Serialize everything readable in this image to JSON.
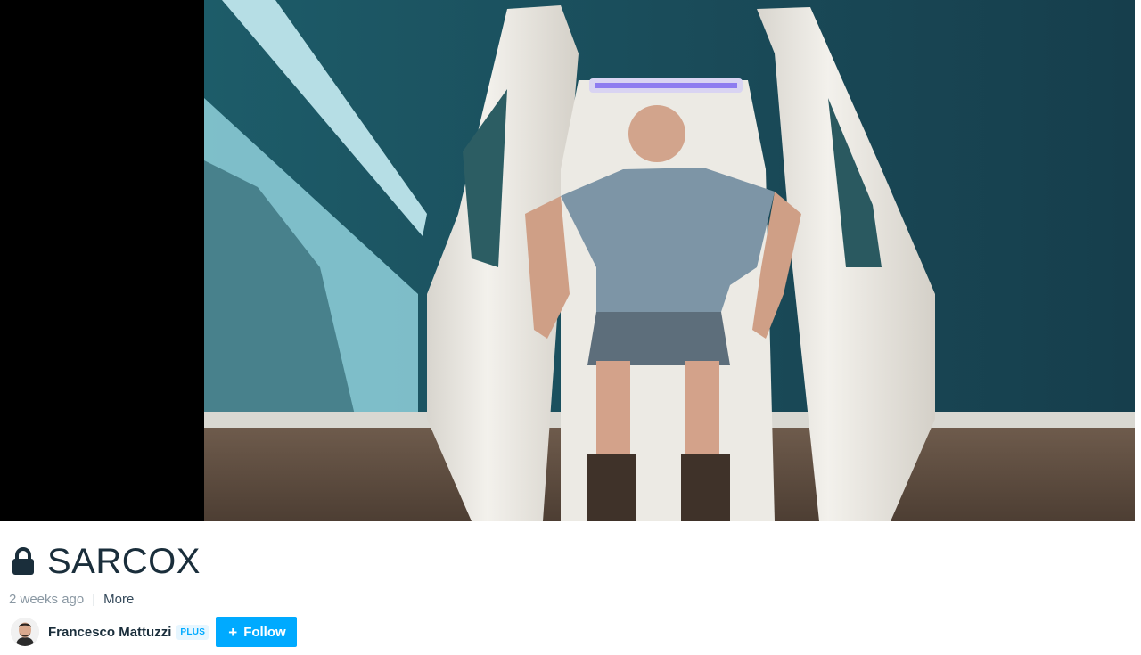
{
  "video": {
    "title": "SARCOX",
    "date": "2 weeks ago",
    "more_label": "More",
    "locked": true
  },
  "author": {
    "name": "Francesco Mattuzzi",
    "badge": "PLUS",
    "follow_label": "Follow"
  },
  "icons": {
    "lock": "lock-icon",
    "plus": "plus-icon",
    "avatar": "avatar"
  },
  "colors": {
    "accent": "#00aaff",
    "title_text": "#1a2e3b",
    "muted_text": "#8a98a3"
  }
}
